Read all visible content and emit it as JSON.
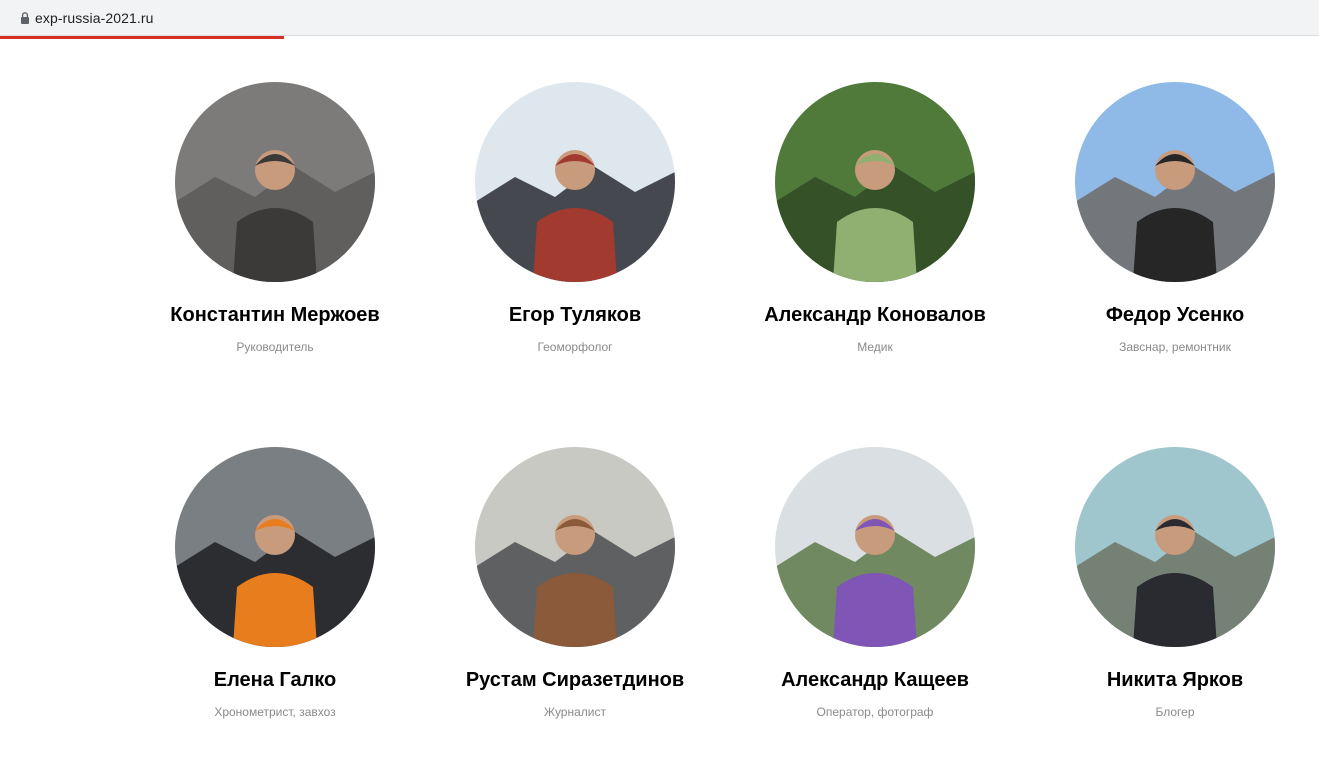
{
  "browser": {
    "url": "exp-russia-2021.ru",
    "lock_icon": "lock-icon",
    "load_progress": 0.215,
    "progress_color": "#d93025"
  },
  "team": {
    "members": [
      {
        "name": "Константин Мержоев",
        "role": "Руководитель",
        "photo_palette": [
          "#7d7b79",
          "#5c5a58",
          "#3b3a39"
        ]
      },
      {
        "name": "Егор Туляков",
        "role": "Геоморфолог",
        "photo_palette": [
          "#dfe7ee",
          "#2a2d33",
          "#a33a2f"
        ]
      },
      {
        "name": "Александр Коновалов",
        "role": "Медик",
        "photo_palette": [
          "#4f7a3a",
          "#2f4a24",
          "#8fb070"
        ]
      },
      {
        "name": "Федор Усенко",
        "role": "Завснар, ремонтник",
        "photo_palette": [
          "#8fb9e6",
          "#6e6a66",
          "#262626"
        ]
      },
      {
        "name": "Елена Галко",
        "role": "Хронометрист, завхоз",
        "photo_palette": [
          "#7a7f84",
          "#1e1e22",
          "#e87d1e"
        ]
      },
      {
        "name": "Рустам Сиразетдинов",
        "role": "Журналист",
        "photo_palette": [
          "#c9c9c4",
          "#4b4d50",
          "#8a5a3a"
        ]
      },
      {
        "name": "Александр Кащеев",
        "role": "Оператор, фотограф",
        "photo_palette": [
          "#d9dfe2",
          "#5e7a4a",
          "#7f55b5"
        ]
      },
      {
        "name": "Никита Ярков",
        "role": "Блогер",
        "photo_palette": [
          "#9fc6cc",
          "#6f7466",
          "#2a2b30"
        ]
      }
    ]
  }
}
